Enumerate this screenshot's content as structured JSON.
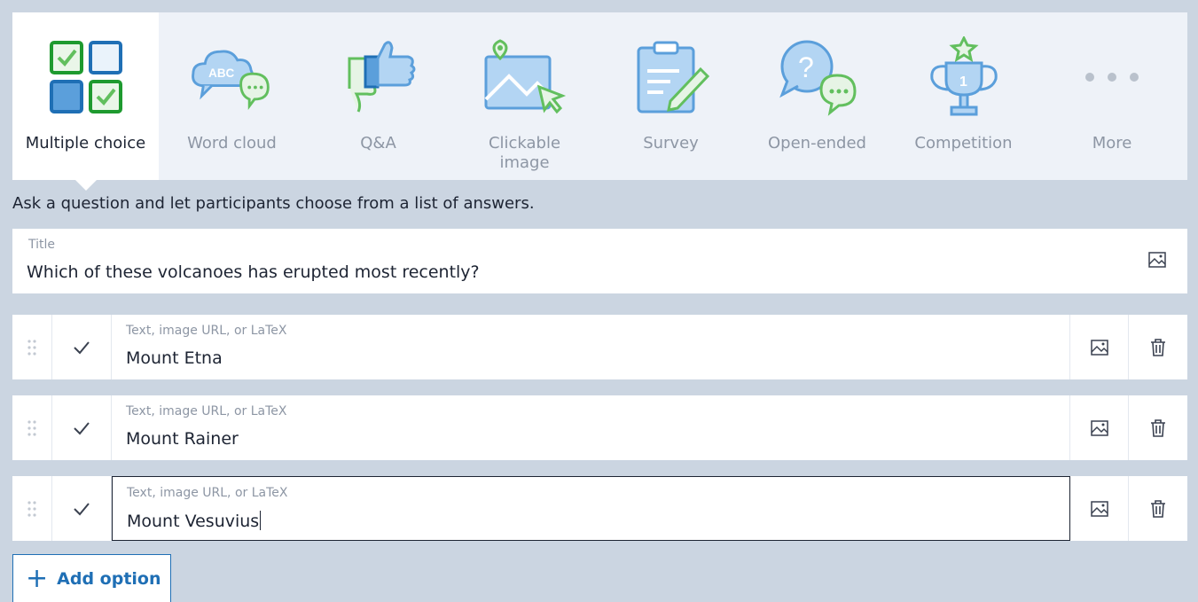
{
  "question_types": [
    {
      "label": "Multiple choice",
      "icon": "multiple-choice-icon",
      "active": true
    },
    {
      "label": "Word cloud",
      "icon": "word-cloud-icon",
      "active": false
    },
    {
      "label": "Q&A",
      "icon": "thumbs-icon",
      "active": false
    },
    {
      "label": "Clickable\nimage",
      "icon": "clickable-image-icon",
      "active": false
    },
    {
      "label": "Survey",
      "icon": "survey-clipboard-icon",
      "active": false
    },
    {
      "label": "Open-ended",
      "icon": "open-ended-icon",
      "active": false
    },
    {
      "label": "Competition",
      "icon": "trophy-icon",
      "active": false
    },
    {
      "label": "More",
      "icon": "more-dots-icon",
      "active": false
    }
  ],
  "description": "Ask a question and let participants choose from a list of answers.",
  "title": {
    "label": "Title",
    "value": "Which of these volcanoes has erupted most recently?"
  },
  "options": [
    {
      "placeholder": "Text, image URL, or LaTeX",
      "value": "Mount Etna",
      "focused": false
    },
    {
      "placeholder": "Text, image URL, or LaTeX",
      "value": "Mount Rainer",
      "focused": false
    },
    {
      "placeholder": "Text, image URL, or LaTeX",
      "value": "Mount Vesuvius",
      "focused": true
    }
  ],
  "add_option_label": "Add option",
  "add_option_plus": "+",
  "colors": {
    "green": "#1e9a2f",
    "blue": "#1f6fb5",
    "icon_fill": "#b3d5f3",
    "icon_stroke": "#5b9fdb",
    "icon_green": "#62bf5e",
    "active_label": "#1d2433",
    "inactive_label": "#8d96a4",
    "background": "#cbd5e1"
  }
}
